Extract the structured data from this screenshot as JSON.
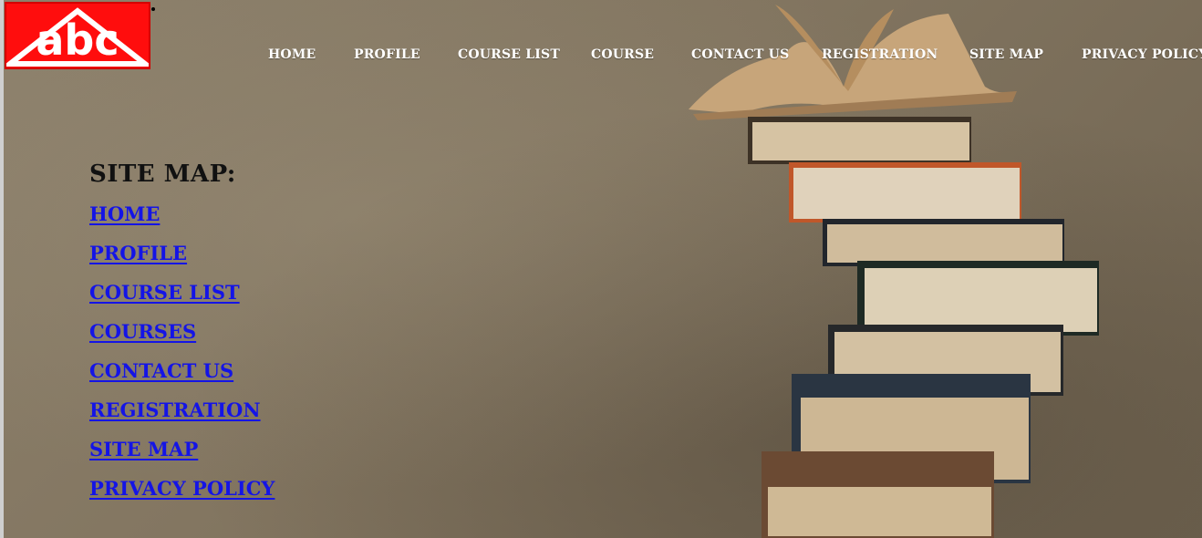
{
  "logo": {
    "text": "abc",
    "bg_color": "#ff0d0d"
  },
  "nav": {
    "items": [
      {
        "label": "HOME"
      },
      {
        "label": "PROFILE"
      },
      {
        "label": "COURSE LIST"
      },
      {
        "label": "COURSE"
      },
      {
        "label": "CONTACT US"
      },
      {
        "label": "REGISTRATION"
      },
      {
        "label": "SITE MAP"
      },
      {
        "label": "PRIVACY POLICY"
      }
    ],
    "color": "#ffffff"
  },
  "sitemap": {
    "title": "SITE MAP:",
    "links": [
      {
        "label": "HOME"
      },
      {
        "label": "PROFILE"
      },
      {
        "label": "COURSE LIST"
      },
      {
        "label": "COURSES"
      },
      {
        "label": "CONTACT US"
      },
      {
        "label": "REGISTRATION"
      },
      {
        "label": "SITE MAP"
      },
      {
        "label": "PRIVACY POLICY"
      }
    ],
    "link_color": "#1414e6"
  },
  "background": {
    "image": "stack-of-books-image"
  }
}
